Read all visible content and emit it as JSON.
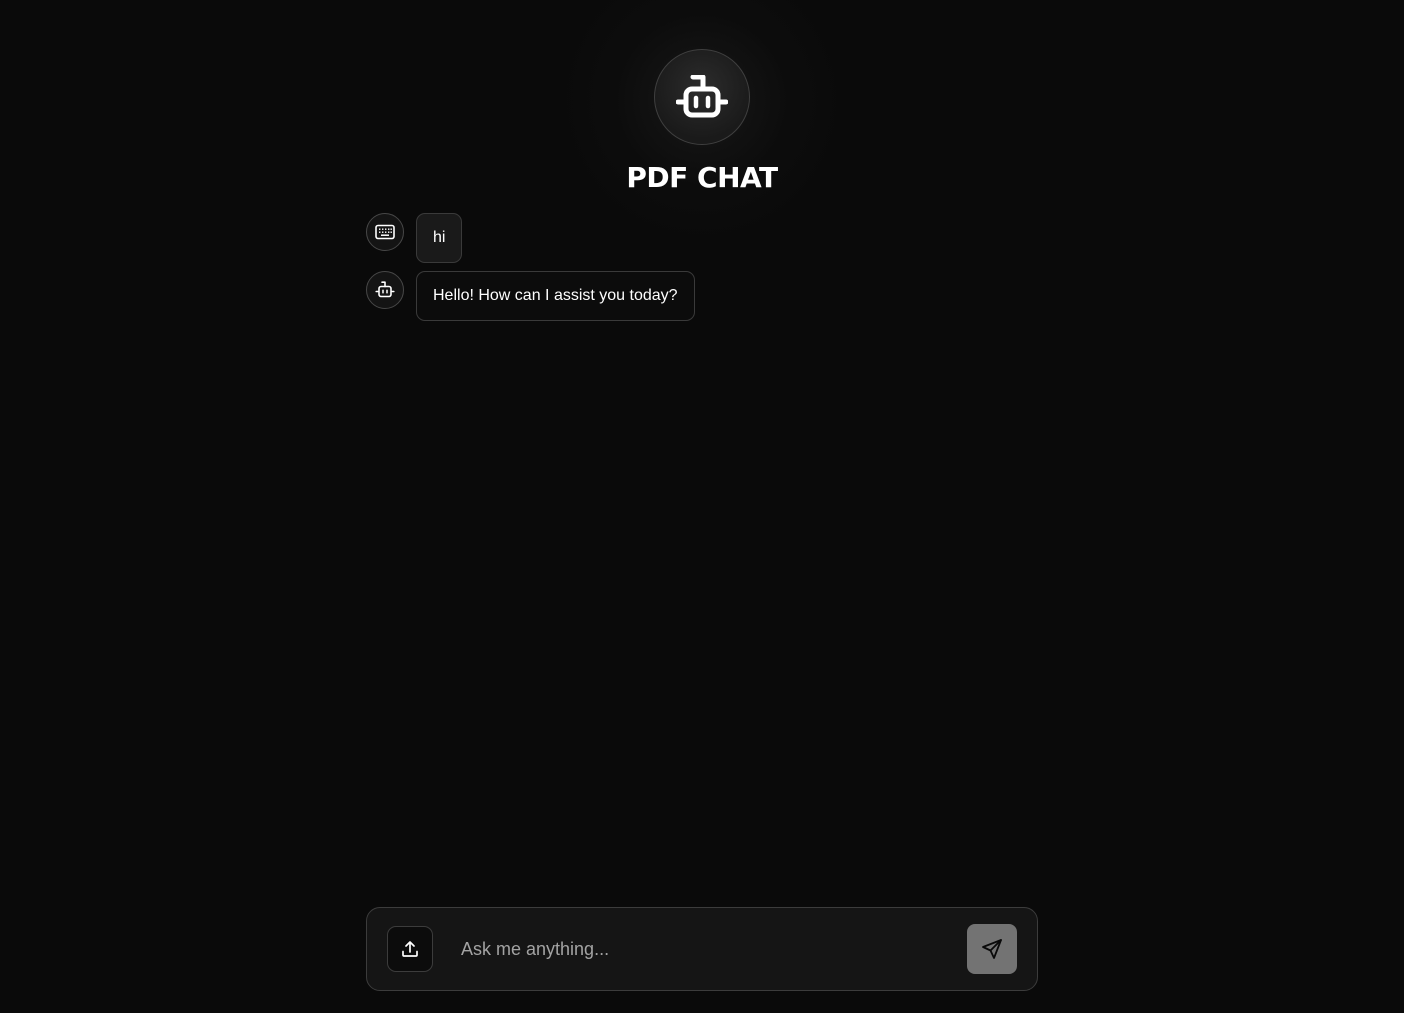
{
  "header": {
    "title": "PDF CHAT",
    "avatar_icon": "bot-icon"
  },
  "messages": [
    {
      "role": "user",
      "icon": "keyboard-icon",
      "text": "hi"
    },
    {
      "role": "assistant",
      "icon": "bot-icon",
      "text": "Hello! How can I assist you today?"
    }
  ],
  "composer": {
    "upload_icon": "upload-icon",
    "placeholder": "Ask me anything...",
    "value": "",
    "send_icon": "send-icon"
  },
  "colors": {
    "background": "#0a0a0a",
    "send_button": "#737373",
    "border": "#3c3c3c"
  }
}
